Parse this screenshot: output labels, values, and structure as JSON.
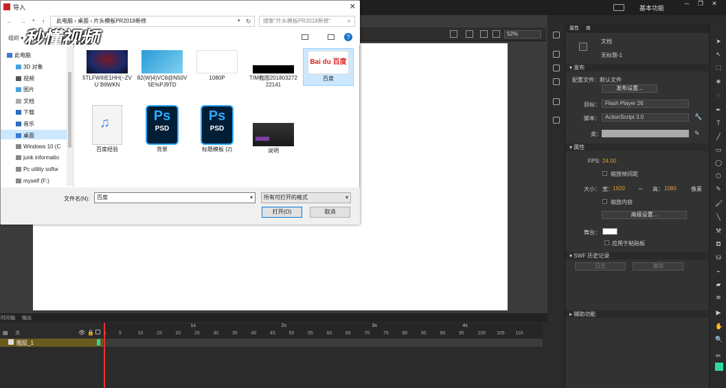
{
  "app": {
    "workspace": "基本功能",
    "zoom": "52%"
  },
  "dialog": {
    "title": "导入",
    "breadcrumb": "此电脑  ›  桌面  ›  片头模板PR2018新修",
    "search_placeholder": "搜索\"片头模板PR2018新修\"",
    "organize": "组织 ▾",
    "watermark": "秒懂视频",
    "nav_items": [
      "此电脑",
      "3D 对象",
      "视频",
      "图片",
      "文档",
      "下载",
      "音乐",
      "桌面",
      "Windows 10 (C",
      "junk informatio",
      "Pc  utility softw",
      "myself (F:)"
    ],
    "files": [
      {
        "name": "5TLFWIIIE1HH(~ZVU`B9WKN",
        "kind": "dark-image"
      },
      {
        "name": "82(W}4)VC8@N50V5E%PJ9TD",
        "kind": "blue-image"
      },
      {
        "name": "1080P",
        "kind": "white-image"
      },
      {
        "name": "TIM截图20180327222141",
        "kind": "black-bar"
      },
      {
        "name": "百度",
        "kind": "baidu"
      },
      {
        "name": "百度经验",
        "kind": "audio"
      },
      {
        "name": "背景",
        "kind": "psd"
      },
      {
        "name": "标题模板 (2)",
        "kind": "psd"
      },
      {
        "name": "说明",
        "kind": "dark-video"
      }
    ],
    "psd_label_top": "Ps",
    "psd_label_bottom": "PSD",
    "baidu_label": "Bai du 百度",
    "filename_label": "文件名(N):",
    "filename_value": "百度",
    "filetype_value": "所有可打开的格式",
    "open_button": "打开(O)",
    "cancel_button": "取消"
  },
  "timeline": {
    "tab_timeline": "时间轴",
    "tab_output": "输出",
    "layer_name": "图层_1",
    "header_label": "关",
    "seconds": [
      "1s",
      "2s",
      "3s",
      "4s"
    ],
    "frame_numbers": [
      "1",
      "5",
      "10",
      "15",
      "20",
      "25",
      "30",
      "35",
      "40",
      "45",
      "50",
      "55",
      "60",
      "65",
      "70",
      "75",
      "80",
      "85",
      "90",
      "95",
      "100",
      "105",
      "110"
    ]
  },
  "properties": {
    "tab_props": "属性",
    "tab_lib": "库",
    "doc_label": "文档",
    "doc_name": "无标题-1",
    "publish_section": "发布",
    "profile_label": "配置文件：默认文件",
    "publish_settings": "发布设置...",
    "target_label": "目标：",
    "target_value": "Flash Player 26",
    "script_label": "脚本：",
    "script_value": "ActionScript 3.0",
    "class_label": "类：",
    "props_section": "属性",
    "fps_label": "FPS:",
    "fps_value": "24.00",
    "scale_spans": "缩放帧间距",
    "size_label": "大小：",
    "width_label": "宽：",
    "width_value": "1920",
    "height_label": "高：",
    "height_value": "1080",
    "unit": "像素",
    "scale_content": "缩放内容",
    "advanced": "高级设置...",
    "stage_label": "舞台：",
    "apply_paste": "应用于粘贴板",
    "swf_section": "SWF 历史记录",
    "log_button": "日志",
    "clear_button": "清除",
    "accessibility_section": "辅助功能"
  },
  "colors": {
    "accent_orange": "#e0a030",
    "selection_blue": "#cce8ff",
    "layer_gold": "#6b5a1e",
    "ps_blue": "#31a8ff",
    "ps_dark": "#001e36"
  }
}
